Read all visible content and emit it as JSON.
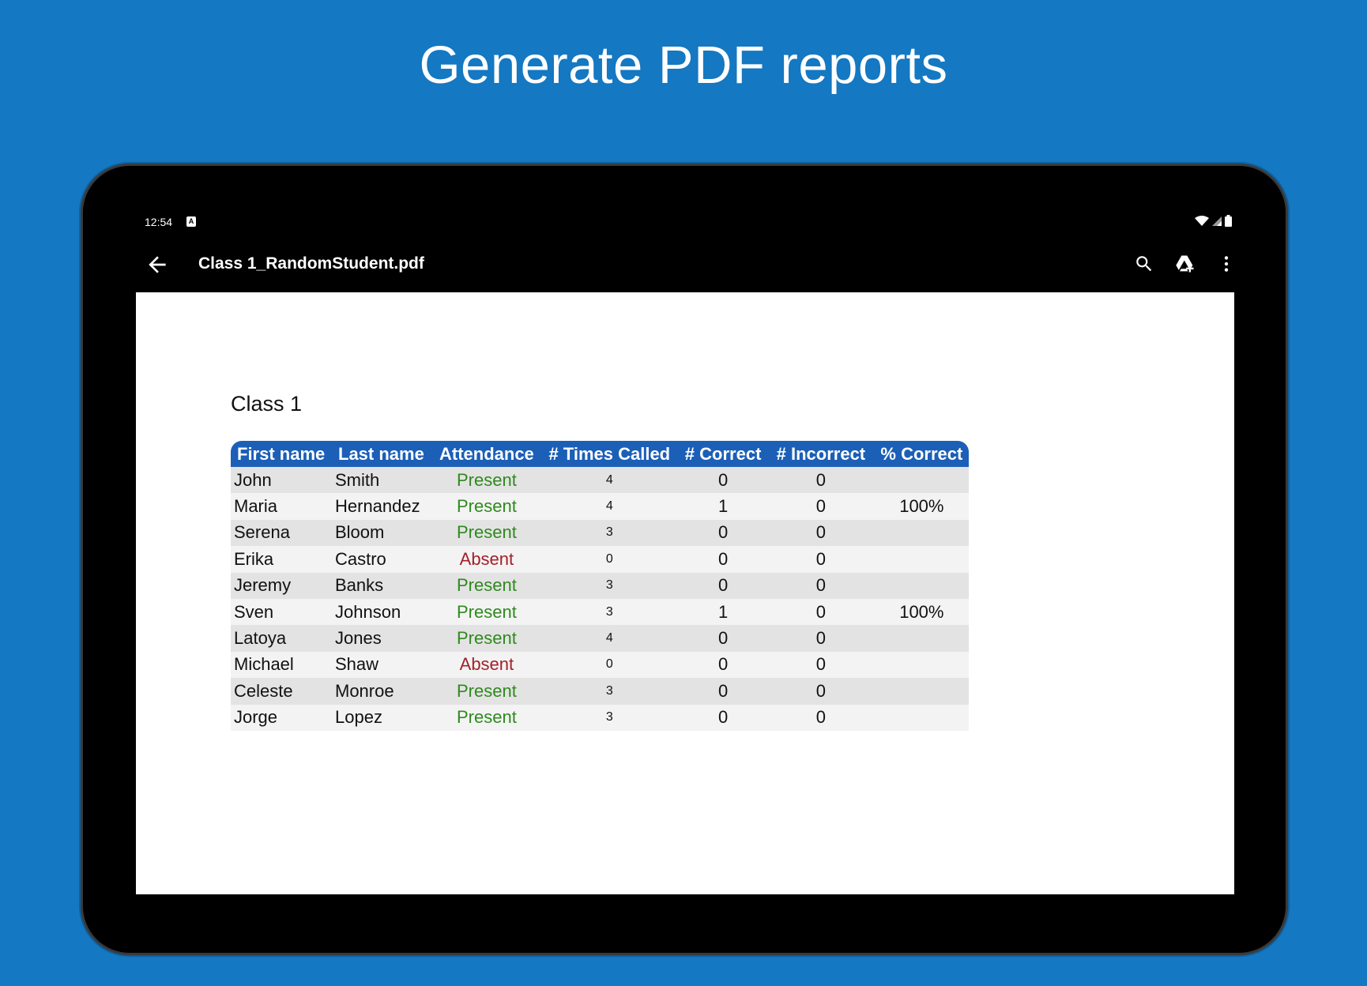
{
  "headline": "Generate PDF reports",
  "status_bar": {
    "time": "12:54",
    "notification_icon": "a-notification-icon",
    "icons": [
      "wifi-icon",
      "cell-signal-icon",
      "battery-icon"
    ]
  },
  "toolbar": {
    "back_icon": "arrow-back-icon",
    "title": "Class 1_RandomStudent.pdf",
    "actions": [
      "search-icon",
      "drive-add-icon",
      "more-vert-icon"
    ]
  },
  "document": {
    "class_title": "Class 1",
    "columns": [
      "First name",
      "Last name",
      "Attendance",
      "# Times Called",
      "# Correct",
      "# Incorrect",
      "% Correct"
    ],
    "rows": [
      {
        "first": "John",
        "last": "Smith",
        "attendance": "Present",
        "times": "4",
        "correct": "0",
        "incorrect": "0",
        "pct": ""
      },
      {
        "first": "Maria",
        "last": "Hernandez",
        "attendance": "Present",
        "times": "4",
        "correct": "1",
        "incorrect": "0",
        "pct": "100%"
      },
      {
        "first": "Serena",
        "last": "Bloom",
        "attendance": "Present",
        "times": "3",
        "correct": "0",
        "incorrect": "0",
        "pct": ""
      },
      {
        "first": "Erika",
        "last": "Castro",
        "attendance": "Absent",
        "times": "0",
        "correct": "0",
        "incorrect": "0",
        "pct": ""
      },
      {
        "first": "Jeremy",
        "last": "Banks",
        "attendance": "Present",
        "times": "3",
        "correct": "0",
        "incorrect": "0",
        "pct": ""
      },
      {
        "first": "Sven",
        "last": "Johnson",
        "attendance": "Present",
        "times": "3",
        "correct": "1",
        "incorrect": "0",
        "pct": "100%"
      },
      {
        "first": "Latoya",
        "last": "Jones",
        "attendance": "Present",
        "times": "4",
        "correct": "0",
        "incorrect": "0",
        "pct": ""
      },
      {
        "first": "Michael",
        "last": "Shaw",
        "attendance": "Absent",
        "times": "0",
        "correct": "0",
        "incorrect": "0",
        "pct": ""
      },
      {
        "first": "Celeste",
        "last": "Monroe",
        "attendance": "Present",
        "times": "3",
        "correct": "0",
        "incorrect": "0",
        "pct": ""
      },
      {
        "first": "Jorge",
        "last": "Lopez",
        "attendance": "Present",
        "times": "3",
        "correct": "0",
        "incorrect": "0",
        "pct": ""
      }
    ]
  },
  "colors": {
    "background": "#1478c2",
    "header_fill": "#1b5fb7",
    "present": "#2f8a1e",
    "absent": "#a3202a"
  }
}
